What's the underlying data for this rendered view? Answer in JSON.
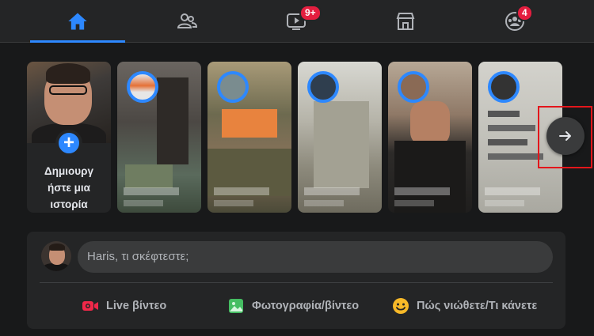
{
  "nav": {
    "items": [
      {
        "name": "home-icon",
        "active": true
      },
      {
        "name": "friends-icon"
      },
      {
        "name": "watch-icon",
        "badge": "9+"
      },
      {
        "name": "marketplace-icon"
      },
      {
        "name": "groups-icon",
        "badge": "4"
      }
    ],
    "accent": "#2d88ff",
    "badge_color": "#e41e3f"
  },
  "stories": {
    "create_label_line1": "Δημιουργ",
    "create_label_line2": "ήστε μια",
    "create_label_line3": "ιστορία",
    "plus": "+"
  },
  "composer": {
    "placeholder": "Haris, τι σκέφτεστε;",
    "actions": [
      {
        "label": "Live βίντεο",
        "icon": "live-video-icon",
        "color": "#f02849"
      },
      {
        "label": "Φωτογραφία/βίντεο",
        "icon": "photo-video-icon",
        "color": "#45bd62"
      },
      {
        "label": "Πώς νιώθετε/Τι κάνετε",
        "icon": "feeling-icon",
        "color": "#f7b928"
      }
    ]
  }
}
